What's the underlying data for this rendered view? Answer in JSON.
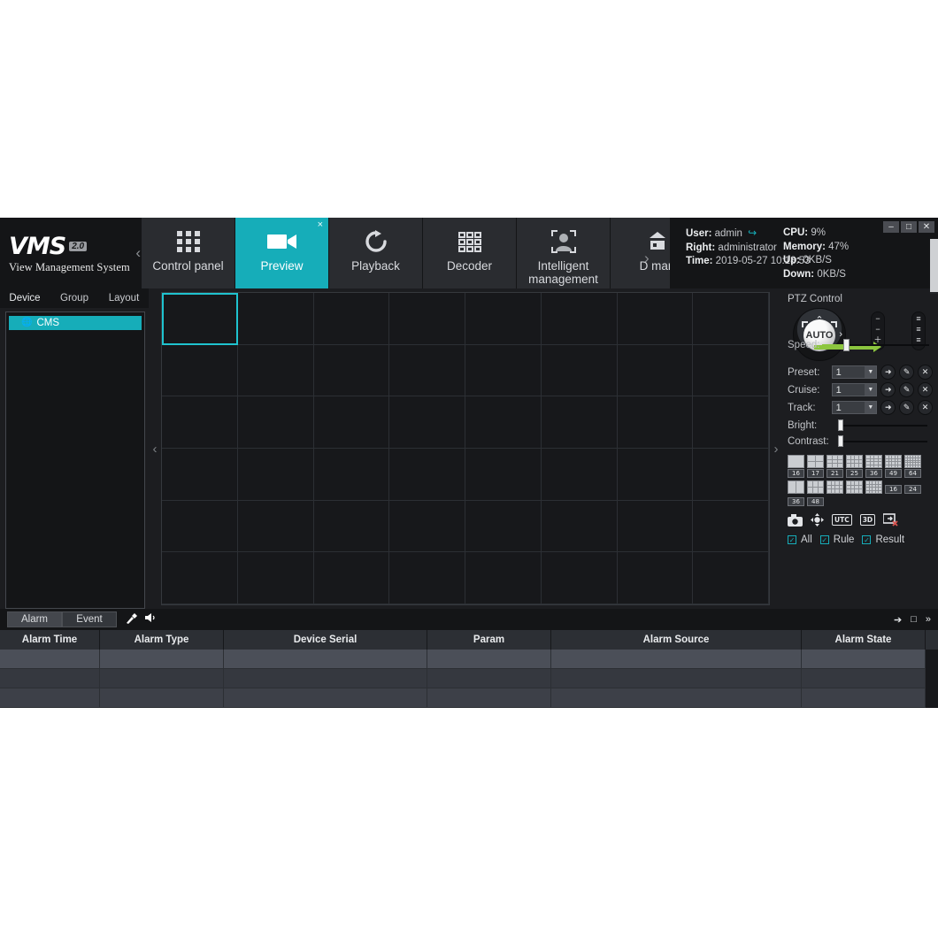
{
  "brand": {
    "name": "VMS",
    "version": "2.0",
    "subtitle": "View Management System"
  },
  "nav": {
    "tabs": [
      {
        "label": "Control panel",
        "icon": "grid-9-icon",
        "active": false,
        "closable": false
      },
      {
        "label": "Preview",
        "icon": "camera-icon",
        "active": true,
        "closable": true
      },
      {
        "label": "Playback",
        "icon": "refresh-icon",
        "active": false,
        "closable": false
      },
      {
        "label": "Decoder",
        "icon": "grid-9-squares-icon",
        "active": false,
        "closable": false
      },
      {
        "label": "Intelligent management",
        "icon": "person-face-icon",
        "active": false,
        "closable": false
      },
      {
        "label": "D man",
        "icon": "device-icon",
        "active": false,
        "closable": false
      }
    ],
    "close_glyph": "×",
    "prev_arrow": "‹",
    "next_arrow": "›"
  },
  "status": {
    "user_label": "User:",
    "user_value": "admin",
    "logout_icon": "logout-icon",
    "right_label": "Right:",
    "right_value": "administrator",
    "time_label": "Time:",
    "time_value": "2019-05-27 10:18:53",
    "cpu_label": "CPU:",
    "cpu_value": "9%",
    "memory_label": "Memory:",
    "memory_value": "47%",
    "up_label": "Up:",
    "up_value": "0KB/S",
    "down_label": "Down:",
    "down_value": "0KB/S"
  },
  "window_buttons": {
    "minimize": "–",
    "maximize": "□",
    "close": "✕"
  },
  "sidebar": {
    "tabs": [
      {
        "label": "Device",
        "active": true
      },
      {
        "label": "Group",
        "active": false
      },
      {
        "label": "Layout",
        "active": false
      }
    ],
    "tree": [
      {
        "label": "CMS",
        "icon": "globe-icon",
        "selected": true
      }
    ]
  },
  "video": {
    "columns": 8,
    "rows": 6,
    "selected_cell": 0
  },
  "ptz": {
    "title": "PTZ Control",
    "joystick_label": "AUTO",
    "up_arrow": "⌃",
    "right_arrow": "›",
    "speed_label": "Speed:",
    "speed_value": 22,
    "zoom_column": [
      "−",
      "−",
      "＋"
    ],
    "focus_column": [
      "≡",
      "≡",
      "≡"
    ],
    "rows": [
      {
        "label": "Preset:",
        "value": "1",
        "actions": [
          "goto-icon",
          "edit-icon",
          "delete-icon"
        ]
      },
      {
        "label": "Cruise:",
        "value": "1",
        "actions": [
          "goto-icon",
          "edit-icon",
          "delete-icon"
        ]
      },
      {
        "label": "Track:",
        "value": "1",
        "actions": [
          "goto-icon",
          "edit-icon",
          "delete-icon"
        ]
      }
    ],
    "sliders": [
      {
        "label": "Bright:",
        "value": 0
      },
      {
        "label": "Contrast:",
        "value": 0
      }
    ],
    "layouts_row1": [
      {
        "num": "16",
        "cols": 1,
        "rows": 1
      },
      {
        "num": "17",
        "cols": 2,
        "rows": 2
      },
      {
        "num": "21",
        "cols": 3,
        "rows": 3
      },
      {
        "num": "25",
        "cols": 4,
        "rows": 3
      },
      {
        "num": "36",
        "cols": 4,
        "rows": 4
      },
      {
        "num": "49",
        "cols": 5,
        "rows": 4
      },
      {
        "num": "64",
        "cols": 6,
        "rows": 5
      }
    ],
    "layouts_row2": [
      {
        "num": "",
        "cols": 2,
        "rows": 1
      },
      {
        "num": "",
        "cols": 3,
        "rows": 2
      },
      {
        "num": "",
        "cols": 4,
        "rows": 3
      },
      {
        "num": "",
        "cols": 4,
        "rows": 3
      },
      {
        "num": "",
        "cols": 5,
        "rows": 4
      },
      {
        "num": "16",
        "cols": 0,
        "rows": 0
      },
      {
        "num": "24",
        "cols": 0,
        "rows": 0
      }
    ],
    "layouts_row3": [
      {
        "num": "36",
        "cols": 0,
        "rows": 0
      },
      {
        "num": "48",
        "cols": 0,
        "rows": 0
      }
    ],
    "tools": [
      {
        "icon": "snapshot-camera-icon",
        "glyph": "◉",
        "type": "glyph"
      },
      {
        "icon": "ptz-pad-icon",
        "glyph": "✥",
        "type": "glyph"
      },
      {
        "icon": "utc-icon",
        "glyph": "UTC",
        "type": "box"
      },
      {
        "icon": "three-d-icon",
        "glyph": "3D",
        "type": "box"
      },
      {
        "icon": "close-preview-icon",
        "glyph": "❐",
        "type": "glyph"
      }
    ],
    "checkboxes": [
      {
        "label": "All",
        "checked": true
      },
      {
        "label": "Rule",
        "checked": true
      },
      {
        "label": "Result",
        "checked": true
      }
    ],
    "check_glyph": "✓"
  },
  "alarm": {
    "tabs": [
      {
        "label": "Alarm",
        "active": true
      },
      {
        "label": "Event",
        "active": false
      }
    ],
    "bar_icons": [
      {
        "name": "clear-broom-icon",
        "glyph": "✐"
      },
      {
        "name": "sound-icon",
        "glyph": "🔊"
      }
    ],
    "bar_right_icons": [
      {
        "name": "pin-icon",
        "glyph": "➔"
      },
      {
        "name": "maximize-icon",
        "glyph": "□"
      },
      {
        "name": "collapse-icon",
        "glyph": "»"
      }
    ],
    "columns": [
      "Alarm Time",
      "Alarm Type",
      "Device Serial",
      "Param",
      "Alarm Source",
      "Alarm State"
    ],
    "rows": [
      [
        "",
        "",
        "",
        "",
        "",
        ""
      ],
      [
        "",
        "",
        "",
        "",
        "",
        ""
      ],
      [
        "",
        "",
        "",
        "",
        "",
        ""
      ]
    ]
  },
  "colors": {
    "accent": "#16adb9",
    "selection": "#1fc3cf",
    "green": "#8cc63f",
    "panel": "#1c1d20",
    "dark": "#141517"
  }
}
